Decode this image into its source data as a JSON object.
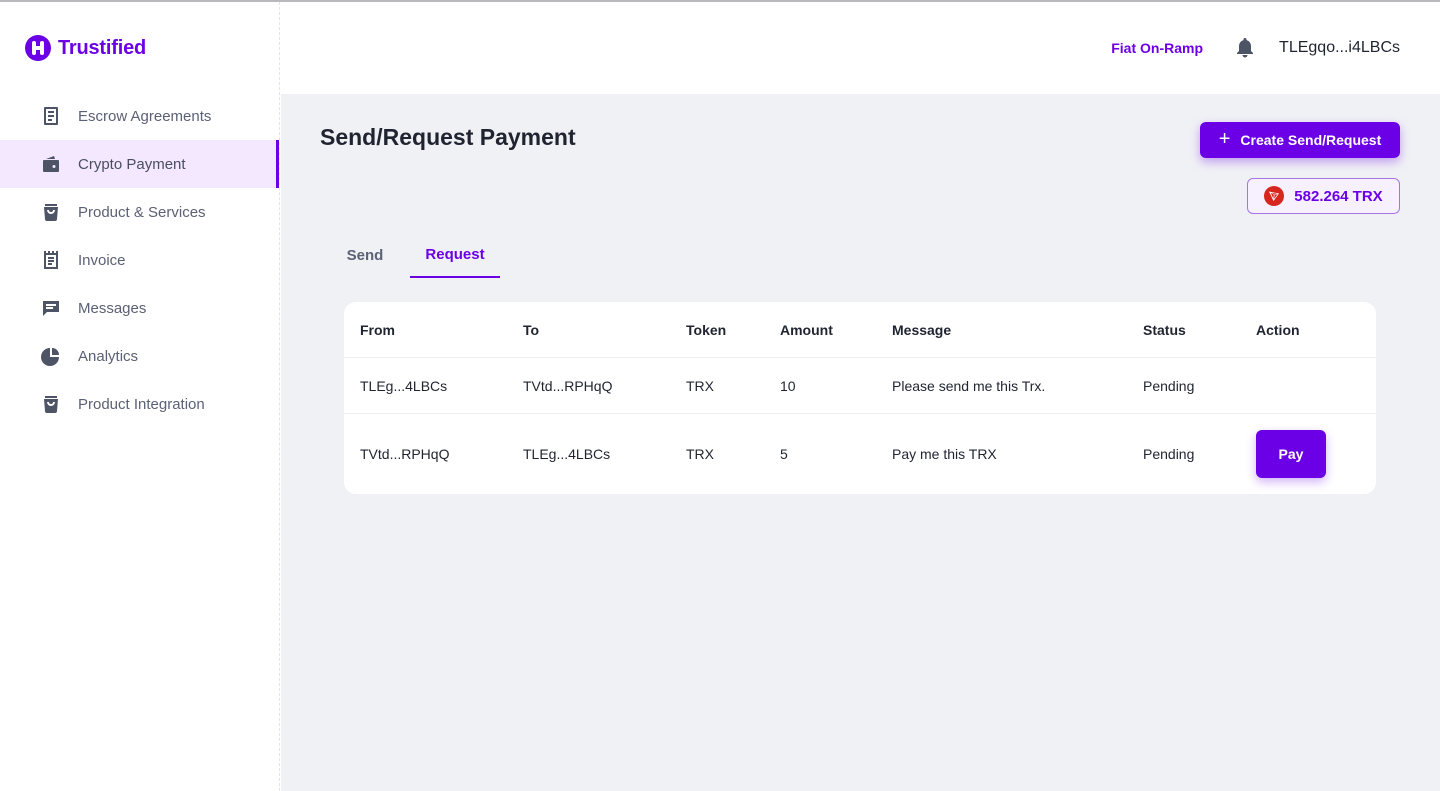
{
  "app": {
    "name": "Trustified",
    "brand_color": "#6b00e6"
  },
  "sidebar": {
    "items": [
      {
        "label": "Escrow Agreements",
        "icon": "document-icon"
      },
      {
        "label": "Crypto Payment",
        "icon": "wallet-icon",
        "active": true
      },
      {
        "label": "Product & Services",
        "icon": "shopping-bag-icon"
      },
      {
        "label": "Invoice",
        "icon": "receipt-icon"
      },
      {
        "label": "Messages",
        "icon": "message-icon"
      },
      {
        "label": "Analytics",
        "icon": "pie-chart-icon"
      },
      {
        "label": "Product Integration",
        "icon": "integration-bag-icon"
      }
    ]
  },
  "header": {
    "fiat_link": "Fiat On-Ramp",
    "wallet_address": "TLEgqo...i4LBCs"
  },
  "main": {
    "title": "Send/Request Payment",
    "create_button": "Create Send/Request",
    "balance": "582.264 TRX",
    "tabs": [
      {
        "label": "Send",
        "active": false
      },
      {
        "label": "Request",
        "active": true
      }
    ],
    "table": {
      "headers": [
        "From",
        "To",
        "Token",
        "Amount",
        "Message",
        "Status",
        "Action"
      ],
      "rows": [
        {
          "from": "TLEg...4LBCs",
          "to": "TVtd...RPHqQ",
          "token": "TRX",
          "amount": "10",
          "message": "Please send me this Trx.",
          "status": "Pending",
          "action": ""
        },
        {
          "from": "TVtd...RPHqQ",
          "to": "TLEg...4LBCs",
          "token": "TRX",
          "amount": "5",
          "message": "Pay me this TRX",
          "status": "Pending",
          "action": "Pay"
        }
      ]
    }
  }
}
